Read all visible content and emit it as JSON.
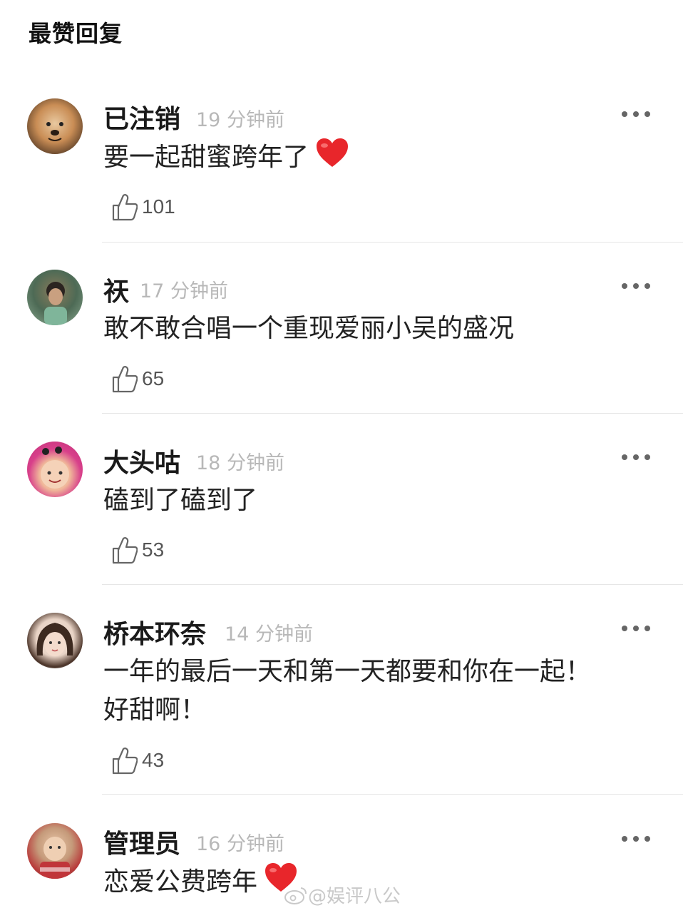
{
  "header": {
    "title": "最赞回复"
  },
  "comments": [
    {
      "username": "已注销",
      "time": "19 分钟前",
      "text": "要一起甜蜜跨年了",
      "emoji": "red-heart",
      "likes": "101"
    },
    {
      "username": "祆",
      "time": "17 分钟前",
      "text": "敢不敢合唱一个重现爱丽小吴的盛况",
      "likes": "65"
    },
    {
      "username": "大头咕",
      "time": "18 分钟前",
      "text": "磕到了磕到了",
      "likes": "53"
    },
    {
      "username": "桥本环奈",
      "time": "14 分钟前",
      "text_line1": "一年的最后一天和第一天都要和你在一起！",
      "text_line2": "好甜啊！",
      "likes": "43"
    },
    {
      "username": "管理员",
      "time": "16 分钟前",
      "text": "恋爱公费跨年",
      "emoji": "red-heart"
    }
  ],
  "watermark": {
    "text": "@娱评八公",
    "icon": "weibo-icon"
  },
  "colors": {
    "heart": "#e8262b",
    "time": "#b8b8b8",
    "divider": "#e6e6e6"
  }
}
